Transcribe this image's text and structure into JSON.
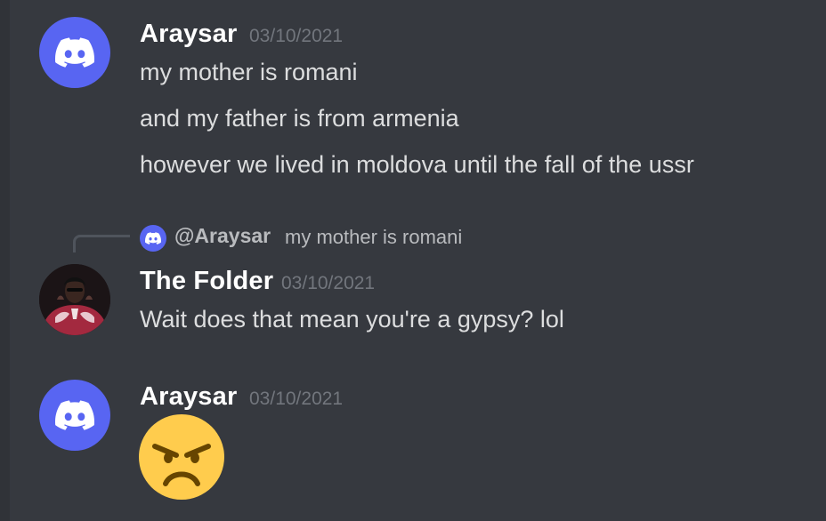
{
  "messages": [
    {
      "author": "Araysar",
      "timestamp": "03/10/2021",
      "avatar_icon": "discord-logo-icon",
      "lines": [
        "my mother is romani",
        "and my father is from armenia",
        "however we lived in moldova until the fall of the ussr"
      ]
    },
    {
      "reply": {
        "author": "@Araysar",
        "text": "my mother is romani",
        "avatar_icon": "discord-logo-icon"
      },
      "author": "The Folder",
      "timestamp": "03/10/2021",
      "avatar_icon": "user-photo-avatar",
      "lines": [
        "Wait does that mean you're a gypsy? lol"
      ]
    },
    {
      "author": "Araysar",
      "timestamp": "03/10/2021",
      "avatar_icon": "discord-logo-icon",
      "emoji": "angry-face-emoji"
    }
  ],
  "colors": {
    "background": "#36393f",
    "blurple": "#5865f2",
    "username": "#ffffff",
    "timestamp": "#72767d",
    "text": "#dcddde",
    "emoji_face": "#ffcc4d"
  }
}
